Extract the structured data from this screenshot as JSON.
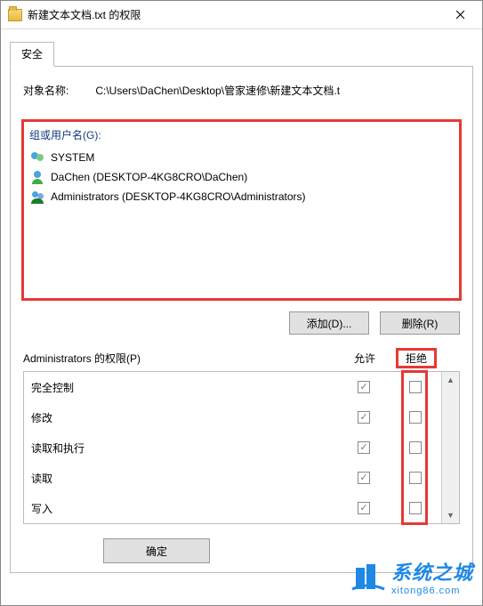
{
  "titlebar": {
    "title": "新建文本文档.txt 的权限"
  },
  "tab": {
    "security_label": "安全"
  },
  "object": {
    "label": "对象名称:",
    "path": "C:\\Users\\DaChen\\Desktop\\管家速修\\新建文本文档.t"
  },
  "group": {
    "label": "组或用户名(G):",
    "items": [
      {
        "name": "SYSTEM",
        "icon": "two"
      },
      {
        "name": "DaChen (DESKTOP-4KG8CRO\\DaChen)",
        "icon": "one"
      },
      {
        "name": "Administrators (DESKTOP-4KG8CRO\\Administrators)",
        "icon": "grp"
      }
    ]
  },
  "buttons": {
    "add": "添加(D)...",
    "remove": "删除(R)",
    "ok": "确定"
  },
  "perm": {
    "header_label": "Administrators 的权限(P)",
    "allow_label": "允许",
    "deny_label": "拒绝",
    "rows": [
      {
        "name": "完全控制",
        "allow": true,
        "deny": false
      },
      {
        "name": "修改",
        "allow": true,
        "deny": false
      },
      {
        "name": "读取和执行",
        "allow": true,
        "deny": false
      },
      {
        "name": "读取",
        "allow": true,
        "deny": false
      },
      {
        "name": "写入",
        "allow": true,
        "deny": false
      }
    ]
  },
  "watermark": {
    "line1": "系统之城",
    "line2": "xitong86.com"
  }
}
